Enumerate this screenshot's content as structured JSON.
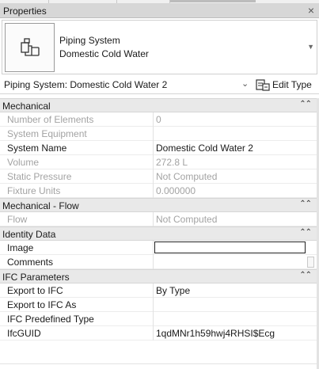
{
  "palette": {
    "title_bar": "#d7d7d7",
    "group_header": "#e9e9e9",
    "disabled_text": "#a3a3a3"
  },
  "panel": {
    "title": "Properties",
    "close_glyph": "×"
  },
  "type_selector": {
    "icon": "piping-system-icon",
    "family": "Piping System",
    "type": "Domestic Cold Water",
    "dropdown_glyph": "▼"
  },
  "instance": {
    "label": "Piping System: Domestic Cold Water 2",
    "chevron": "⌄",
    "edit_type_label": "Edit Type"
  },
  "collapse_glyph": "⌃⌃",
  "groups": [
    {
      "name": "Mechanical",
      "rows": [
        {
          "key": "Number of Elements",
          "value": "0",
          "disabled": true
        },
        {
          "key": "System Equipment",
          "value": "",
          "disabled": true
        },
        {
          "key": "System Name",
          "value": "Domestic Cold Water 2",
          "disabled": false
        },
        {
          "key": "Volume",
          "value": "272.8 L",
          "disabled": true
        },
        {
          "key": "Static Pressure",
          "value": "Not Computed",
          "disabled": true
        },
        {
          "key": "Fixture Units",
          "value": "0.000000",
          "disabled": true
        }
      ]
    },
    {
      "name": "Mechanical - Flow",
      "rows": [
        {
          "key": "Flow",
          "value": "Not Computed",
          "disabled": true
        }
      ]
    },
    {
      "name": "Identity Data",
      "rows": [
        {
          "key": "Image",
          "value": "",
          "disabled": false,
          "input": true
        },
        {
          "key": "Comments",
          "value": "",
          "disabled": false,
          "scrollstub": true
        }
      ]
    },
    {
      "name": "IFC Parameters",
      "rows": [
        {
          "key": "Export to IFC",
          "value": "By Type",
          "disabled": false
        },
        {
          "key": "Export to IFC As",
          "value": "",
          "disabled": false
        },
        {
          "key": "IFC Predefined Type",
          "value": "",
          "disabled": false
        },
        {
          "key": "IfcGUID",
          "value": "1qdMNr1h59hwj4RHSI$Ecg",
          "disabled": false
        }
      ]
    }
  ]
}
